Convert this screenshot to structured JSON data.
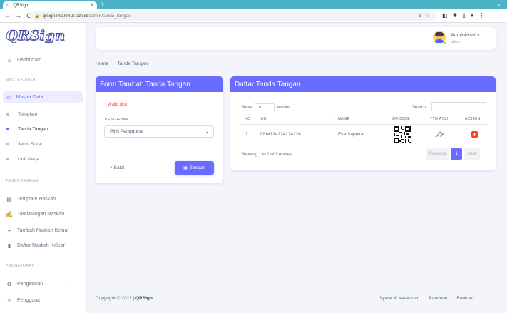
{
  "browser": {
    "tab_title": "QRSign",
    "tab_close": "×",
    "new_tab": "+",
    "url_host": "qrsign.mianmur.sch.id",
    "url_path": "/admin/tanda_tangan",
    "back": "←",
    "forward": "→",
    "reload": "C"
  },
  "sidebar": {
    "logo": "QRSign",
    "dashboard": "Dashboard",
    "section_master": "MASTER DATA",
    "master_data": "Master Data",
    "master_items": [
      {
        "label": "Template",
        "active": false
      },
      {
        "label": "Tanda Tangan",
        "active": true
      },
      {
        "label": "Jenis Surat",
        "active": false
      },
      {
        "label": "Unit Kerja",
        "active": false
      }
    ],
    "section_ttd": "TANDA TANGAN",
    "ttd_items": [
      "Template Naskah",
      "Tandatangan Naskah",
      "Tambah Naskah Keluar",
      "Daftar Naskah Keluar"
    ],
    "section_settings": "PENGATURAN",
    "pengaturan": "Pengaturan",
    "pengguna": "Pengguna"
  },
  "topbar": {
    "user_name": "Administrator",
    "user_role": "admin"
  },
  "breadcrumb": {
    "home": "Home",
    "separator": "›",
    "current": "Tanda Tangan"
  },
  "form": {
    "title": "Form Tambah Tanda Tangan",
    "required_note": "* Wajib diisi",
    "field_label": "PENGGUNA",
    "select_value": "Pilih Pengguna",
    "cancel_label": "Batal",
    "save_label": "Simpan"
  },
  "list": {
    "title": "Daftar Tanda Tangan",
    "show_label": "Show",
    "length_value": "10",
    "entries_label": "entries",
    "search_label": "Search:",
    "columns": [
      "NO",
      "NIK",
      "NAME",
      "QRCODE",
      "TTD ASLI",
      "ACTION"
    ],
    "rows": [
      {
        "no": "1",
        "nik": "1214124124124124",
        "name": "Eka Saputra"
      }
    ],
    "info": "Showing 1 to 1 of 1 entries",
    "prev": "Previous",
    "page": "1",
    "next": "Next"
  },
  "footer": {
    "copyright": "Copyright © 2022 |",
    "brand": "QRSign",
    "links": [
      "Syarat & Ketentuan",
      "Panduan",
      "Bantuan"
    ]
  },
  "colors": {
    "primary": "#696cff",
    "danger": "#ff3e1d",
    "browser_bar": "#4cb2c6"
  }
}
